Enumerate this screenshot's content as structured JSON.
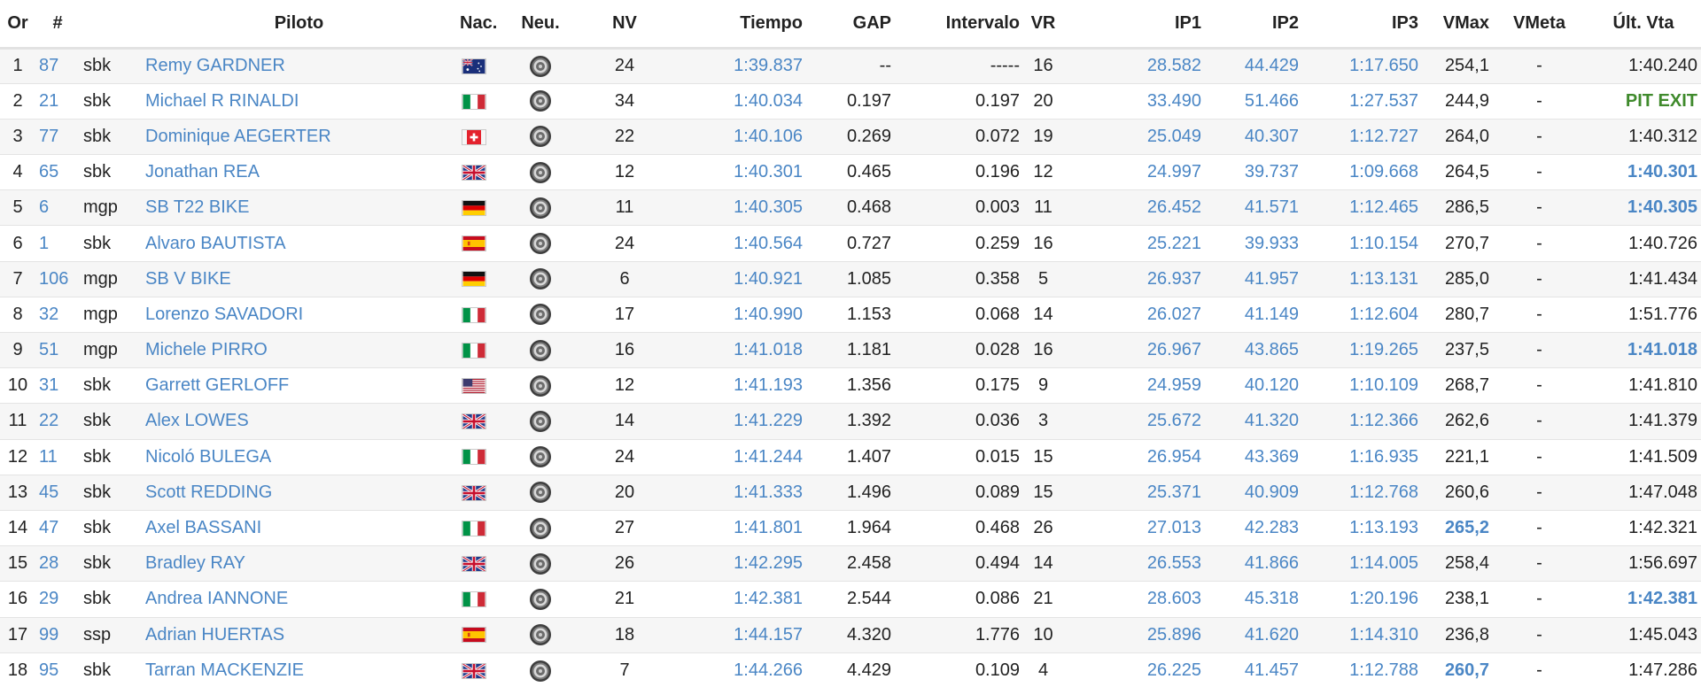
{
  "colors": {
    "link": "#4a86c5",
    "pit_exit": "#3f8a2c",
    "pit_icon": "#9c3a2c",
    "check_icon": "#3f87c9",
    "row_stripe": "#f6f6f6"
  },
  "headers": {
    "pos": "Or",
    "num": "#",
    "pilot": "Piloto",
    "nat": "Nac.",
    "tyre": "Neu.",
    "laps": "NV",
    "time": "Tiempo",
    "gap": "GAP",
    "interval": "Intervalo",
    "vr": "VR",
    "ip1": "IP1",
    "ip2": "IP2",
    "ip3": "IP3",
    "vmax": "VMax",
    "vmeta": "VMeta",
    "last": "Últ. Vta"
  },
  "rows": [
    {
      "pos": "1",
      "num": "87",
      "cls": "sbk",
      "name": "Remy GARDNER",
      "flag": "aus",
      "tyre": "tyre-icon",
      "laps": "24",
      "time": "1:39.837",
      "gap": "--",
      "interval": "-----",
      "vr": "16",
      "ip1": "28.582",
      "ip2": "44.429",
      "ip3": "1:17.650",
      "vmax": "254,1",
      "vmax_best": false,
      "vmeta": "-",
      "last": "1:40.240",
      "last_style": "normal",
      "status": "pit-icon"
    },
    {
      "pos": "2",
      "num": "21",
      "cls": "sbk",
      "name": "Michael R RINALDI",
      "flag": "ita",
      "tyre": "tyre-icon",
      "laps": "34",
      "time": "1:40.034",
      "gap": "0.197",
      "interval": "0.197",
      "vr": "20",
      "ip1": "33.490",
      "ip2": "51.466",
      "ip3": "1:27.537",
      "vmax": "244,9",
      "vmax_best": false,
      "vmeta": "-",
      "last": "PIT EXIT",
      "last_style": "pit",
      "status": "pit-icon"
    },
    {
      "pos": "3",
      "num": "77",
      "cls": "sbk",
      "name": "Dominique AEGERTER",
      "flag": "sui",
      "tyre": "tyre-icon",
      "laps": "22",
      "time": "1:40.106",
      "gap": "0.269",
      "interval": "0.072",
      "vr": "19",
      "ip1": "25.049",
      "ip2": "40.307",
      "ip3": "1:12.727",
      "vmax": "264,0",
      "vmax_best": false,
      "vmeta": "-",
      "last": "1:40.312",
      "last_style": "normal",
      "status": "pit-icon"
    },
    {
      "pos": "4",
      "num": "65",
      "cls": "sbk",
      "name": "Jonathan REA",
      "flag": "gbr",
      "tyre": "tyre-icon",
      "laps": "12",
      "time": "1:40.301",
      "gap": "0.465",
      "interval": "0.196",
      "vr": "12",
      "ip1": "24.997",
      "ip2": "39.737",
      "ip3": "1:09.668",
      "vmax": "264,5",
      "vmax_best": false,
      "vmeta": "-",
      "last": "1:40.301",
      "last_style": "best",
      "status": "check-icon"
    },
    {
      "pos": "5",
      "num": "6",
      "cls": "mgp",
      "name": "SB T22 BIKE",
      "flag": "ger",
      "tyre": "tyre-icon",
      "laps": "11",
      "time": "1:40.305",
      "gap": "0.468",
      "interval": "0.003",
      "vr": "11",
      "ip1": "26.452",
      "ip2": "41.571",
      "ip3": "1:12.465",
      "vmax": "286,5",
      "vmax_best": false,
      "vmeta": "-",
      "last": "1:40.305",
      "last_style": "best",
      "status": "pit-icon"
    },
    {
      "pos": "6",
      "num": "1",
      "cls": "sbk",
      "name": "Alvaro BAUTISTA",
      "flag": "esp",
      "tyre": "tyre-icon",
      "laps": "24",
      "time": "1:40.564",
      "gap": "0.727",
      "interval": "0.259",
      "vr": "16",
      "ip1": "25.221",
      "ip2": "39.933",
      "ip3": "1:10.154",
      "vmax": "270,7",
      "vmax_best": false,
      "vmeta": "-",
      "last": "1:40.726",
      "last_style": "normal",
      "status": ""
    },
    {
      "pos": "7",
      "num": "106",
      "cls": "mgp",
      "name": "SB V BIKE",
      "flag": "ger",
      "tyre": "tyre-icon",
      "laps": "6",
      "time": "1:40.921",
      "gap": "1.085",
      "interval": "0.358",
      "vr": "5",
      "ip1": "26.937",
      "ip2": "41.957",
      "ip3": "1:13.131",
      "vmax": "285,0",
      "vmax_best": false,
      "vmeta": "-",
      "last": "1:41.434",
      "last_style": "normal",
      "status": "pit-icon"
    },
    {
      "pos": "8",
      "num": "32",
      "cls": "mgp",
      "name": "Lorenzo SAVADORI",
      "flag": "ita",
      "tyre": "tyre-icon",
      "laps": "17",
      "time": "1:40.990",
      "gap": "1.153",
      "interval": "0.068",
      "vr": "14",
      "ip1": "26.027",
      "ip2": "41.149",
      "ip3": "1:12.604",
      "vmax": "280,7",
      "vmax_best": false,
      "vmeta": "-",
      "last": "1:51.776",
      "last_style": "normal",
      "status": "pit-icon"
    },
    {
      "pos": "9",
      "num": "51",
      "cls": "mgp",
      "name": "Michele PIRRO",
      "flag": "ita",
      "tyre": "tyre-icon",
      "laps": "16",
      "time": "1:41.018",
      "gap": "1.181",
      "interval": "0.028",
      "vr": "16",
      "ip1": "26.967",
      "ip2": "43.865",
      "ip3": "1:19.265",
      "vmax": "237,5",
      "vmax_best": false,
      "vmeta": "-",
      "last": "1:41.018",
      "last_style": "best",
      "status": "pit-icon"
    },
    {
      "pos": "10",
      "num": "31",
      "cls": "sbk",
      "name": "Garrett GERLOFF",
      "flag": "usa",
      "tyre": "tyre-icon",
      "laps": "12",
      "time": "1:41.193",
      "gap": "1.356",
      "interval": "0.175",
      "vr": "9",
      "ip1": "24.959",
      "ip2": "40.120",
      "ip3": "1:10.109",
      "vmax": "268,7",
      "vmax_best": false,
      "vmeta": "-",
      "last": "1:41.810",
      "last_style": "normal",
      "status": "pit-icon"
    },
    {
      "pos": "11",
      "num": "22",
      "cls": "sbk",
      "name": "Alex LOWES",
      "flag": "gbr",
      "tyre": "tyre-icon",
      "laps": "14",
      "time": "1:41.229",
      "gap": "1.392",
      "interval": "0.036",
      "vr": "3",
      "ip1": "25.672",
      "ip2": "41.320",
      "ip3": "1:12.366",
      "vmax": "262,6",
      "vmax_best": false,
      "vmeta": "-",
      "last": "1:41.379",
      "last_style": "normal",
      "status": "pit-icon"
    },
    {
      "pos": "12",
      "num": "11",
      "cls": "sbk",
      "name": "Nicoló BULEGA",
      "flag": "ita",
      "tyre": "tyre-icon",
      "laps": "24",
      "time": "1:41.244",
      "gap": "1.407",
      "interval": "0.015",
      "vr": "15",
      "ip1": "26.954",
      "ip2": "43.369",
      "ip3": "1:16.935",
      "vmax": "221,1",
      "vmax_best": false,
      "vmeta": "-",
      "last": "1:41.509",
      "last_style": "normal",
      "status": "pit-icon"
    },
    {
      "pos": "13",
      "num": "45",
      "cls": "sbk",
      "name": "Scott REDDING",
      "flag": "gbr",
      "tyre": "tyre-icon",
      "laps": "20",
      "time": "1:41.333",
      "gap": "1.496",
      "interval": "0.089",
      "vr": "15",
      "ip1": "25.371",
      "ip2": "40.909",
      "ip3": "1:12.768",
      "vmax": "260,6",
      "vmax_best": false,
      "vmeta": "-",
      "last": "1:47.048",
      "last_style": "normal",
      "status": "pit-icon"
    },
    {
      "pos": "14",
      "num": "47",
      "cls": "sbk",
      "name": "Axel BASSANI",
      "flag": "ita",
      "tyre": "tyre-icon",
      "laps": "27",
      "time": "1:41.801",
      "gap": "1.964",
      "interval": "0.468",
      "vr": "26",
      "ip1": "27.013",
      "ip2": "42.283",
      "ip3": "1:13.193",
      "vmax": "265,2",
      "vmax_best": true,
      "vmeta": "-",
      "last": "1:42.321",
      "last_style": "normal",
      "status": "pit-icon"
    },
    {
      "pos": "15",
      "num": "28",
      "cls": "sbk",
      "name": "Bradley RAY",
      "flag": "gbr",
      "tyre": "tyre-icon",
      "laps": "26",
      "time": "1:42.295",
      "gap": "2.458",
      "interval": "0.494",
      "vr": "14",
      "ip1": "26.553",
      "ip2": "41.866",
      "ip3": "1:14.005",
      "vmax": "258,4",
      "vmax_best": false,
      "vmeta": "-",
      "last": "1:56.697",
      "last_style": "normal",
      "status": "pit-icon"
    },
    {
      "pos": "16",
      "num": "29",
      "cls": "sbk",
      "name": "Andrea IANNONE",
      "flag": "ita",
      "tyre": "tyre-icon",
      "laps": "21",
      "time": "1:42.381",
      "gap": "2.544",
      "interval": "0.086",
      "vr": "21",
      "ip1": "28.603",
      "ip2": "45.318",
      "ip3": "1:20.196",
      "vmax": "238,1",
      "vmax_best": false,
      "vmeta": "-",
      "last": "1:42.381",
      "last_style": "best",
      "status": "pit-icon"
    },
    {
      "pos": "17",
      "num": "99",
      "cls": "ssp",
      "name": "Adrian HUERTAS",
      "flag": "esp",
      "tyre": "tyre-icon",
      "laps": "18",
      "time": "1:44.157",
      "gap": "4.320",
      "interval": "1.776",
      "vr": "10",
      "ip1": "25.896",
      "ip2": "41.620",
      "ip3": "1:14.310",
      "vmax": "236,8",
      "vmax_best": false,
      "vmeta": "-",
      "last": "1:45.043",
      "last_style": "normal",
      "status": "pit-icon"
    },
    {
      "pos": "18",
      "num": "95",
      "cls": "sbk",
      "name": "Tarran MACKENZIE",
      "flag": "gbr",
      "tyre": "tyre-icon",
      "laps": "7",
      "time": "1:44.266",
      "gap": "4.429",
      "interval": "0.109",
      "vr": "4",
      "ip1": "26.225",
      "ip2": "41.457",
      "ip3": "1:12.788",
      "vmax": "260,7",
      "vmax_best": true,
      "vmeta": "-",
      "last": "1:47.286",
      "last_style": "normal",
      "status": "pit-icon"
    }
  ]
}
